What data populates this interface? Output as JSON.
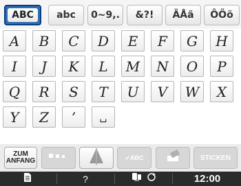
{
  "tabs": [
    {
      "label": "ABC",
      "active": true
    },
    {
      "label": "abc",
      "active": false
    },
    {
      "label": "0~9,.",
      "active": false
    },
    {
      "label": "&?!",
      "active": false
    },
    {
      "label": "ÄÅä",
      "active": false
    },
    {
      "label": "ÔÖö",
      "active": false
    }
  ],
  "keys": [
    [
      "A",
      "B",
      "C",
      "D",
      "E",
      "F",
      "G",
      "H"
    ],
    [
      "I",
      "J",
      "K",
      "L",
      "M",
      "N",
      "O",
      "P"
    ],
    [
      "Q",
      "R",
      "S",
      "T",
      "U",
      "V",
      "W",
      "X"
    ],
    [
      "Y",
      "Z",
      "’",
      "␣"
    ]
  ],
  "function_bar": {
    "home_label_line1": "ZUM",
    "home_label_line2": "ANFANG",
    "array_icon": "spacing-dots-icon",
    "mirror_icon": "mirror-triangles-icon",
    "check_label": "✓ABC",
    "erase_icon": "eraser-icon",
    "sew_label": "STICKEN"
  },
  "status_bar": {
    "doc_icon": "document-icon",
    "help_label": "?",
    "thread_icon": "thread-tension-icon",
    "time": "12:00"
  }
}
